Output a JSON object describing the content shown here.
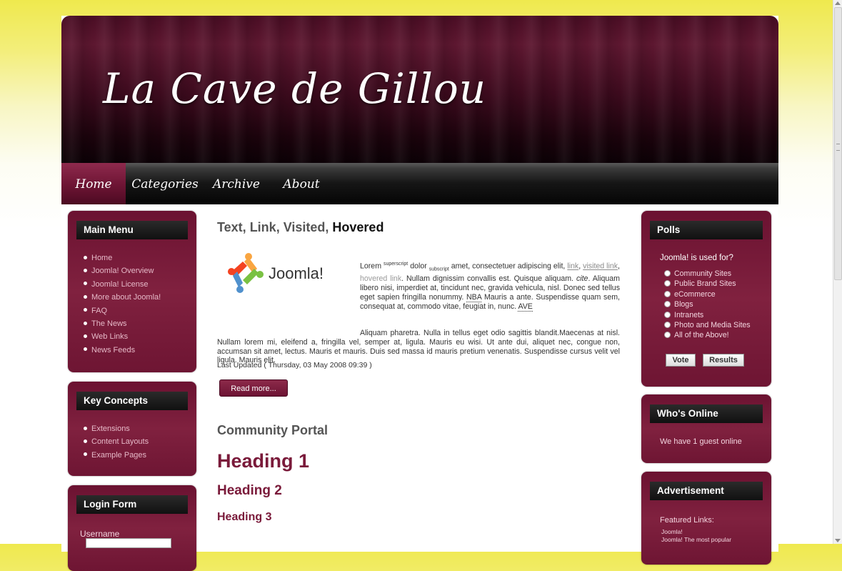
{
  "header": {
    "site_title": "La Cave de Gillou"
  },
  "nav": {
    "items": [
      {
        "label": "Home",
        "active": true
      },
      {
        "label": "Categories",
        "active": false
      },
      {
        "label": "Archive",
        "active": false
      },
      {
        "label": "About",
        "active": false
      }
    ]
  },
  "main_menu": {
    "title": "Main Menu",
    "items": [
      "Home",
      "Joomla! Overview",
      "Joomla! License",
      "More about Joomla!",
      "FAQ",
      "The News",
      "Web Links",
      "News Feeds"
    ]
  },
  "key_concepts": {
    "title": "Key Concepts",
    "items": [
      "Extensions",
      "Content Layouts",
      "Example Pages"
    ]
  },
  "login_form": {
    "title": "Login Form",
    "username_label": "Username",
    "username_value": ""
  },
  "article": {
    "title_parts": [
      "Text, ",
      "Link, ",
      "Visited, ",
      "Hovered"
    ],
    "logo_text": "Joomla!",
    "p1": {
      "lorem": "Lorem ",
      "superscript": "superscript",
      "dolor": " dolor ",
      "subscript": "subscript",
      "amet": " amet, consectetuer adipiscing elit, ",
      "link": "link",
      "comma1": ", ",
      "visited": "visited link",
      "comma2": ", ",
      "hovered": "hovered link",
      "rest1": ". Nullam dignissim convallis est. Quisque aliquam. ",
      "cite": "cite",
      "rest2": ". Aliquam libero nisi, imperdiet at, tincidunt nec, gravida vehicula, nisl. Donec sed tellus eget sapien fringilla nonummy. ",
      "nba": "NBA",
      "rest3": " Mauris a ante. Suspendisse quam sem, consequat at, commodo vitae, feugiat in, nunc. ",
      "ave": "AVE"
    },
    "p2": "Aliquam pharetra. Nulla in tellus eget odio sagittis blandit.Maecenas at nisl. Nullam lorem mi, eleifend a, fringilla vel, semper at, ligula. Mauris eu wisi. Ut ante dui, aliquet nec, congue non, accumsan sit amet, lectus. Mauris et mauris. Duis sed massa id mauris pretium venenatis. Suspendisse cursus velit vel ligula. Mauris elit.",
    "last_updated": "Last Updated ( Thursday, 03 May 2008 09:39 )",
    "read_more": "Read more...",
    "section_title": "Community Portal",
    "heading1": "Heading 1",
    "heading2": "Heading 2",
    "heading3": "Heading 3"
  },
  "polls": {
    "title": "Polls",
    "question": "Joomla! is used for?",
    "options": [
      "Community Sites",
      "Public Brand Sites",
      "eCommerce",
      "Blogs",
      "Intranets",
      "Photo and Media Sites",
      "All of the Above!"
    ],
    "vote_label": "Vote",
    "results_label": "Results"
  },
  "whos_online": {
    "title": "Who's Online",
    "text": "We have 1 guest online"
  },
  "advertisement": {
    "title": "Advertisement",
    "subtitle": "Featured Links:",
    "links": [
      "Joomla!",
      "Joomla! The most popular"
    ]
  },
  "colors": {
    "brand": "#7a1a3a",
    "sidebox": "#80213f",
    "header_dark": "#1b030c",
    "page_top": "#efe94e"
  }
}
